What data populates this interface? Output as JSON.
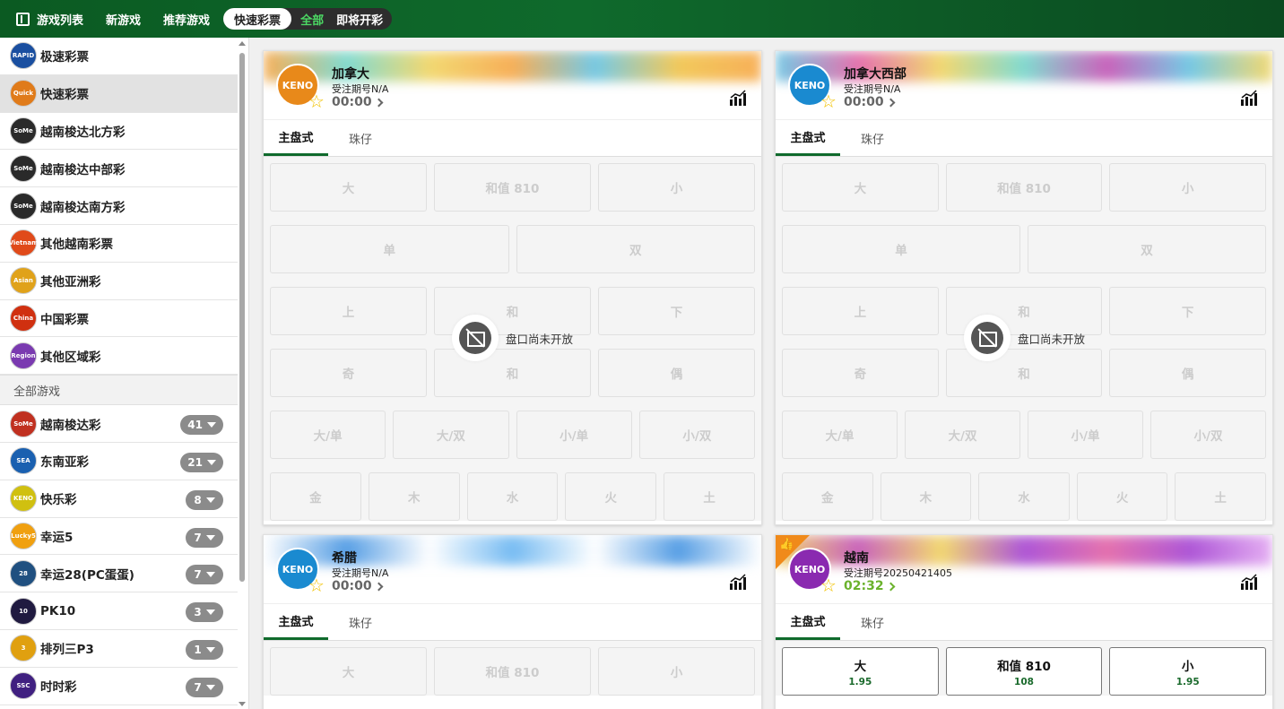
{
  "nav": {
    "game_list": "游戏列表",
    "new_games": "新游戏",
    "recommended": "推荐游戏",
    "quick_lottery": "快速彩票",
    "all": "全部",
    "upcoming": "即将开彩"
  },
  "sidebar": {
    "categories": [
      {
        "label": "极速彩票",
        "logo": "RAPID",
        "color": "#1a4fa0"
      },
      {
        "label": "快速彩票",
        "logo": "Quick",
        "color": "#e07b1a"
      },
      {
        "label": "越南梭达北方彩",
        "logo": "SoMe",
        "color": "#2a2a2a"
      },
      {
        "label": "越南梭达中部彩",
        "logo": "SoMe",
        "color": "#2a2a2a"
      },
      {
        "label": "越南梭达南方彩",
        "logo": "SoMe",
        "color": "#2a2a2a"
      },
      {
        "label": "其他越南彩票",
        "logo": "Vietnam",
        "color": "#e04a1a"
      },
      {
        "label": "其他亚洲彩",
        "logo": "Asian",
        "color": "#e0a21a"
      },
      {
        "label": "中国彩票",
        "logo": "China",
        "color": "#d03010"
      },
      {
        "label": "其他区域彩",
        "logo": "Region",
        "color": "#7a3ab0"
      }
    ],
    "all_games_header": "全部游戏",
    "games": [
      {
        "label": "越南梭达彩",
        "count": "41",
        "logo": "SoMe",
        "color": "#c03020"
      },
      {
        "label": "东南亚彩",
        "count": "21",
        "logo": "SEA",
        "color": "#1a60b0"
      },
      {
        "label": "快乐彩",
        "count": "8",
        "logo": "KENO",
        "color": "#d0c010"
      },
      {
        "label": "幸运5",
        "count": "7",
        "logo": "Lucky5",
        "color": "#f0a010"
      },
      {
        "label": "幸运28(PC蛋蛋)",
        "count": "7",
        "logo": "28",
        "color": "#205080"
      },
      {
        "label": "PK10",
        "count": "3",
        "logo": "10",
        "color": "#201a40"
      },
      {
        "label": "排列三P3",
        "count": "1",
        "logo": "3",
        "color": "#e0a010"
      },
      {
        "label": "时时彩",
        "count": "7",
        "logo": "SSC",
        "color": "#402080"
      }
    ]
  },
  "cards": [
    {
      "title": "加拿大",
      "period": "受注期号N/A",
      "timer": "00:00",
      "logo": "KENO",
      "logo_color": "#e8891a",
      "tabs": [
        "主盘式",
        "珠仔"
      ],
      "closed_text": "盘口尚未开放"
    },
    {
      "title": "加拿大西部",
      "period": "受注期号N/A",
      "timer": "00:00",
      "logo": "KENO",
      "logo_color": "#1a8ad0",
      "tabs": [
        "主盘式",
        "珠仔"
      ],
      "closed_text": "盘口尚未开放"
    },
    {
      "title": "希腊",
      "period": "受注期号N/A",
      "timer": "00:00",
      "logo": "KENO",
      "logo_color": "#1a8ad0",
      "tabs": [
        "主盘式",
        "珠仔"
      ]
    },
    {
      "title": "越南",
      "period": "受注期号20250421405",
      "timer": "02:32",
      "logo": "KENO",
      "logo_color": "#8a2ab0",
      "tabs": [
        "主盘式",
        "珠仔"
      ]
    }
  ],
  "board": {
    "row1": [
      "大",
      "和值 810",
      "小"
    ],
    "row2": [
      "单",
      "双"
    ],
    "row3": [
      "上",
      "和",
      "下"
    ],
    "row4": [
      "奇",
      "和",
      "偶"
    ],
    "row5": [
      "大/单",
      "大/双",
      "小/单",
      "小/双"
    ],
    "row6": [
      "金",
      "木",
      "水",
      "火",
      "土"
    ]
  },
  "vietnam_odds": [
    "1.95",
    "108",
    "1.95"
  ],
  "colors": {
    "brand_green": "#0f6a2c",
    "active_timer": "#6bb22d",
    "badge_orange": "#f08a1a"
  }
}
